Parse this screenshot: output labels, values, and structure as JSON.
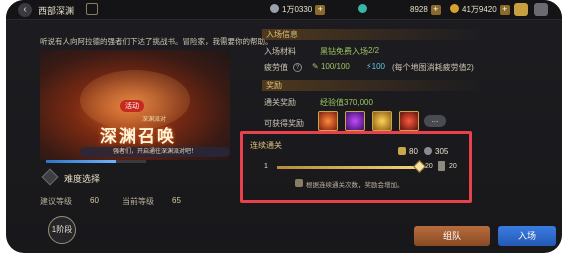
{
  "header": {
    "title": "西部深渊",
    "currency_1": "1万0330",
    "currency_2": "8928",
    "currency_3": "41万9420"
  },
  "story": {
    "text": "听说有人向阿拉德的强者们下达了挑战书。冒险家，我需要你的帮助。"
  },
  "banner": {
    "event_tag": "活动",
    "subtitle": "深渊派对",
    "title": "深渊召唤",
    "tagline": "强者们，开启通往深渊派对吧！"
  },
  "banner_progress": 0.7,
  "difficulty": {
    "label": "难度选择",
    "recommended_label": "建议等级",
    "recommended_value": "60",
    "current_label": "当前等级",
    "current_value": "65",
    "button_label": "1阶段"
  },
  "entry": {
    "section_title": "入场信息",
    "material_label": "入场材料",
    "material_value": "黑钻免费入场",
    "material_count": "2/2",
    "fatigue_label": "疲劳值",
    "fatigue_value": "100/100",
    "fatigue_bonus": "100",
    "fatigue_note": "(每个地图消耗疲劳值2)"
  },
  "rewards": {
    "section_title": "奖励",
    "clear_label": "通关奖励",
    "clear_value": "经验值370,000",
    "obtainable_label": "可获得奖励",
    "more_label": "..."
  },
  "continuous": {
    "title": "连续通关",
    "resource_1": "80",
    "resource_2": "305",
    "slider_min": "1",
    "slider_max": "20",
    "slider_value": 20,
    "count_value": "20",
    "tip": "根据连续通关次数，奖励会增加。"
  },
  "buttons": {
    "team": "组队",
    "enter": "入场"
  },
  "colors": {
    "highlight": "#e8414c",
    "accent_gold": "#e0c27a",
    "enter_blue": "#2f6fd6",
    "team_orange": "#a35a30"
  },
  "icons": [
    "back-icon",
    "map-icon",
    "gold-coin-icon",
    "gem-icon",
    "mail-icon",
    "menu-icon"
  ]
}
